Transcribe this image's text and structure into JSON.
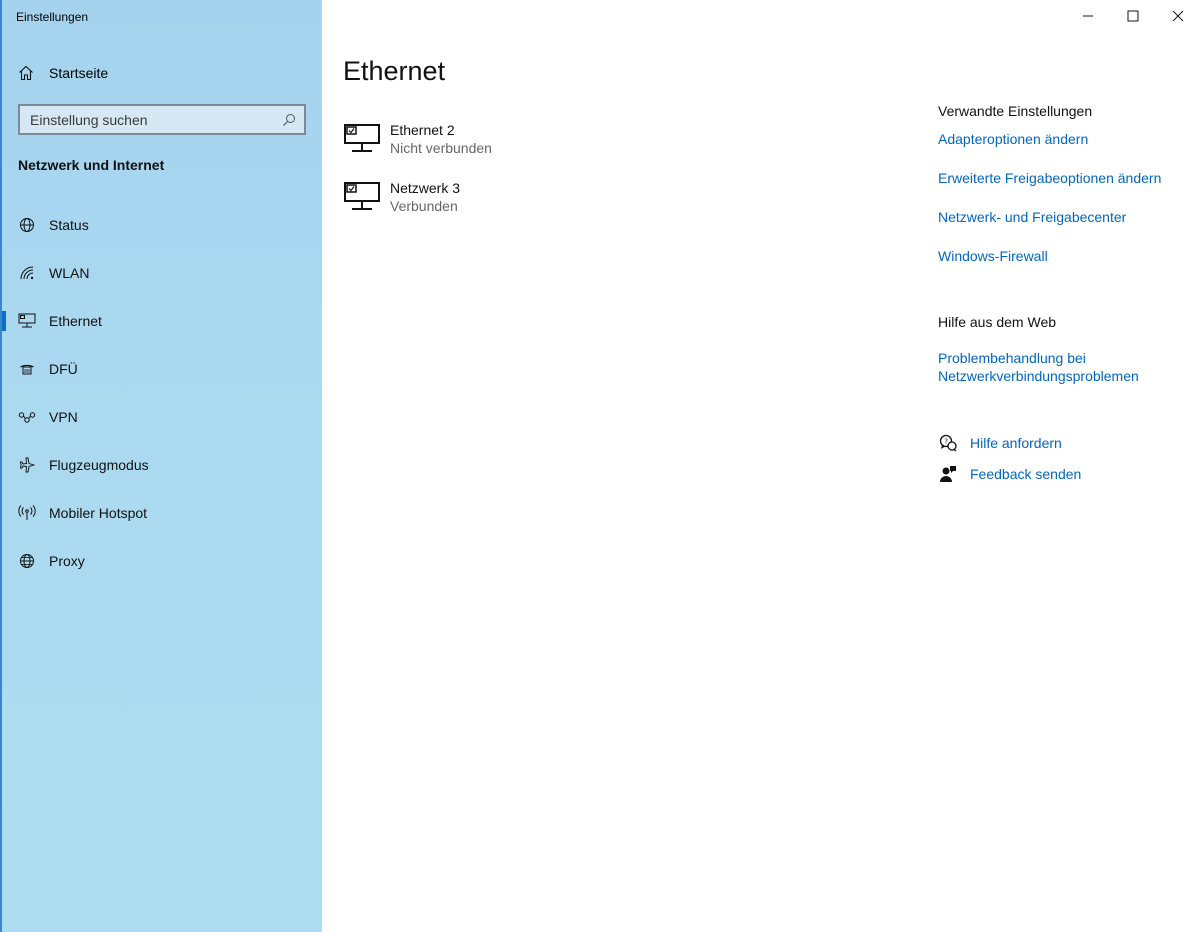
{
  "window": {
    "title": "Einstellungen",
    "controls": [
      "minimize-icon",
      "maximize-icon",
      "close-icon"
    ]
  },
  "sidebar": {
    "home_label": "Startseite",
    "search_placeholder": "Einstellung suchen",
    "section_title": "Netzwerk und Internet",
    "items": [
      {
        "label": "Status",
        "icon": "globe-status-icon",
        "active": false
      },
      {
        "label": "WLAN",
        "icon": "wifi-icon",
        "active": false
      },
      {
        "label": "Ethernet",
        "icon": "ethernet-icon",
        "active": true
      },
      {
        "label": "DFÜ",
        "icon": "dialup-icon",
        "active": false
      },
      {
        "label": "VPN",
        "icon": "vpn-icon",
        "active": false
      },
      {
        "label": "Flugzeugmodus",
        "icon": "airplane-icon",
        "active": false
      },
      {
        "label": "Mobiler Hotspot",
        "icon": "hotspot-icon",
        "active": false
      },
      {
        "label": "Proxy",
        "icon": "globe-icon",
        "active": false
      }
    ]
  },
  "main": {
    "title": "Ethernet",
    "networks": [
      {
        "name": "Ethernet 2",
        "status": "Nicht verbunden"
      },
      {
        "name": "Netzwerk 3",
        "status": "Verbunden"
      }
    ]
  },
  "related": {
    "heading": "Verwandte Einstellungen",
    "links": [
      "Adapteroptionen ändern",
      "Erweiterte Freigabeoptionen ändern",
      "Netzwerk- und Freigabecenter",
      "Windows-Firewall"
    ]
  },
  "web_help": {
    "heading": "Hilfe aus dem Web",
    "link_line1": "Problembehandlung bei",
    "link_line2": "Netzwerkverbindungsproblemen"
  },
  "support": {
    "get_help": "Hilfe anfordern",
    "feedback": "Feedback senden"
  },
  "colors": {
    "accent": "#0a6ecb",
    "link": "#0067c0",
    "sidebar_bg": "#abd9f0"
  }
}
